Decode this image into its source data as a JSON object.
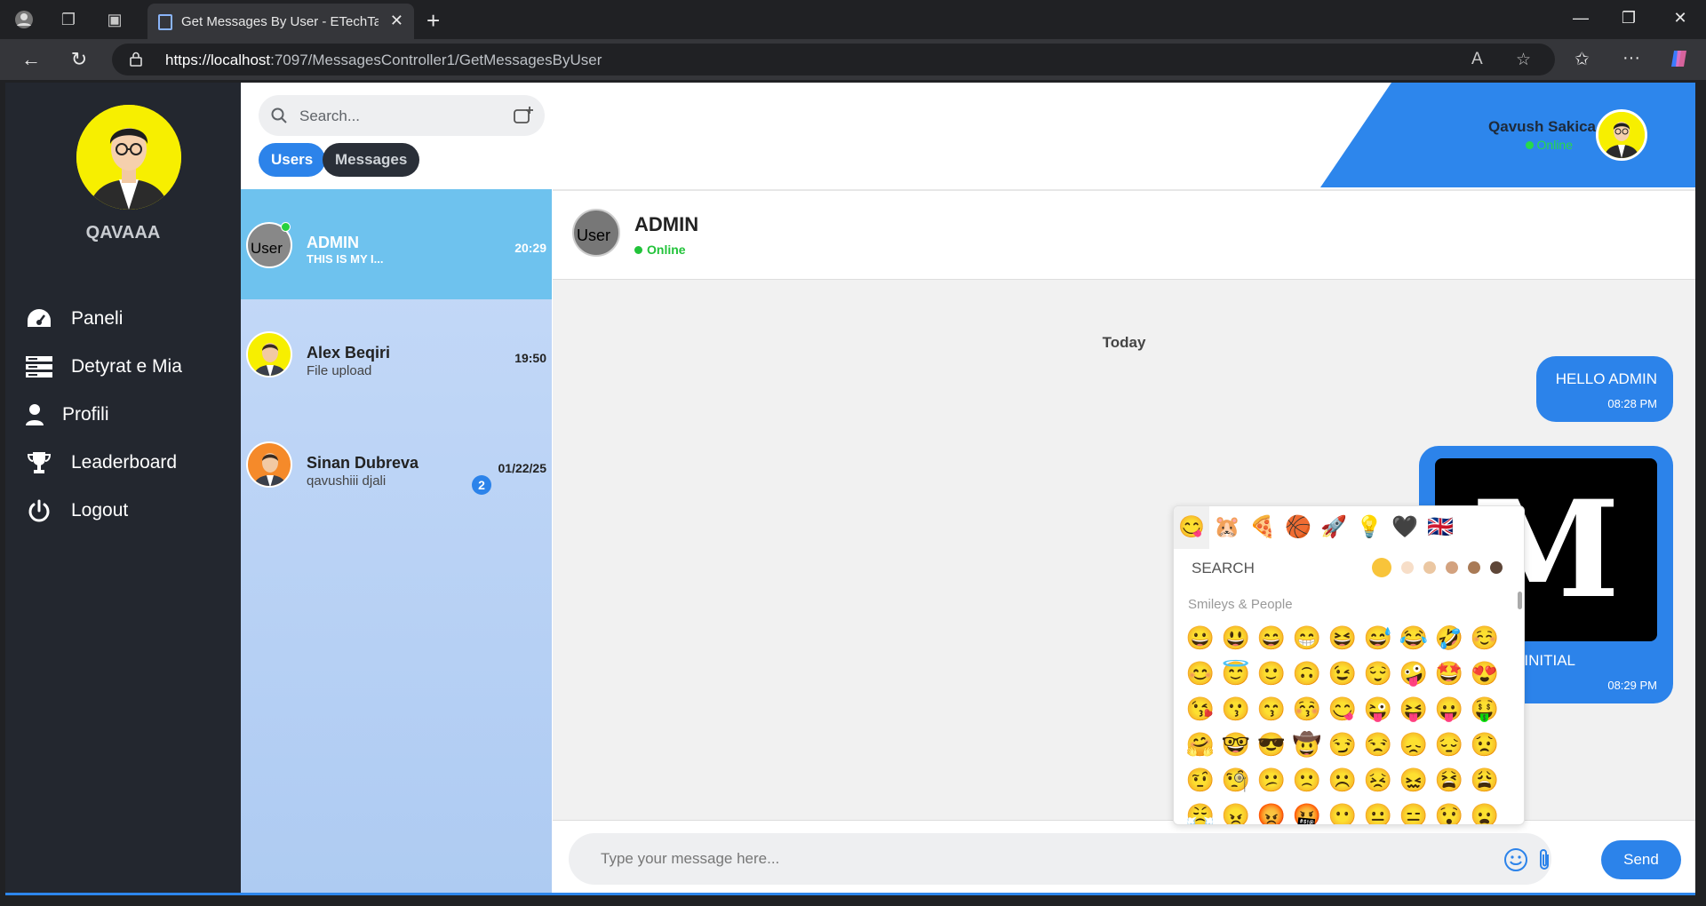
{
  "browser": {
    "tab_title": "Get Messages By User - ETechTask",
    "url_host": "https://localhost",
    "url_rest": ":7097/MessagesController1/GetMessagesByUser"
  },
  "sidebar": {
    "username": "QAVAAA",
    "items": [
      {
        "label": "Paneli",
        "icon": "dashboard-icon"
      },
      {
        "label": "Detyrat e Mia",
        "icon": "tasks-icon"
      },
      {
        "label": "Profili",
        "icon": "user-icon"
      },
      {
        "label": "Leaderboard",
        "icon": "trophy-icon"
      },
      {
        "label": "Logout",
        "icon": "power-icon"
      }
    ]
  },
  "search": {
    "placeholder": "Search..."
  },
  "tabs": {
    "users": "Users",
    "messages": "Messages"
  },
  "users": [
    {
      "name": "ADMIN",
      "last": "THIS IS MY I...",
      "time": "20:29",
      "avatar_alt": "User",
      "active": true
    },
    {
      "name": "Alex Beqiri",
      "last": "File upload",
      "time": "19:50"
    },
    {
      "name": "Sinan Dubreva",
      "last": "qavushiii djali",
      "time": "01/22/25",
      "unread": "2"
    }
  ],
  "me": {
    "name": "Qavush Sakica",
    "status": "Online"
  },
  "chat": {
    "name": "ADMIN",
    "status": "Online",
    "avatar_alt": "User",
    "day": "Today",
    "messages": [
      {
        "text": "HELLO ADMIN",
        "time": "08:28 PM"
      },
      {
        "image_letter": "M",
        "text": "INITIAL",
        "time": "08:29 PM"
      }
    ]
  },
  "input": {
    "placeholder": "Type your message here...",
    "send": "Send"
  },
  "emoji_picker": {
    "categories": [
      "😋",
      "🐹",
      "🍕",
      "🏀",
      "🚀",
      "💡",
      "🖤",
      "🇬🇧"
    ],
    "search_label": "SEARCH",
    "section": "Smileys & People",
    "tones": [
      "#f8c43a",
      "#f7dec8",
      "#ebc7a2",
      "#d3a27f",
      "#a97a56",
      "#5e4638"
    ],
    "emojis": [
      "😀",
      "😃",
      "😄",
      "😁",
      "😆",
      "😅",
      "😂",
      "🤣",
      "☺️",
      "😊",
      "😇",
      "🙂",
      "🙃",
      "😉",
      "😌",
      "🤪",
      "🤩",
      "😍",
      "😘",
      "😗",
      "😙",
      "😚",
      "😋",
      "😜",
      "😝",
      "😛",
      "🤑",
      "🤗",
      "🤓",
      "😎",
      "🤠",
      "😏",
      "😒",
      "😞",
      "😔",
      "😟",
      "🤨",
      "🧐",
      "😕",
      "🙁",
      "☹️",
      "😣",
      "😖",
      "😫",
      "😩",
      "😤",
      "😠",
      "😡",
      "🤬",
      "😶",
      "😐",
      "😑",
      "😯",
      "😦"
    ]
  }
}
